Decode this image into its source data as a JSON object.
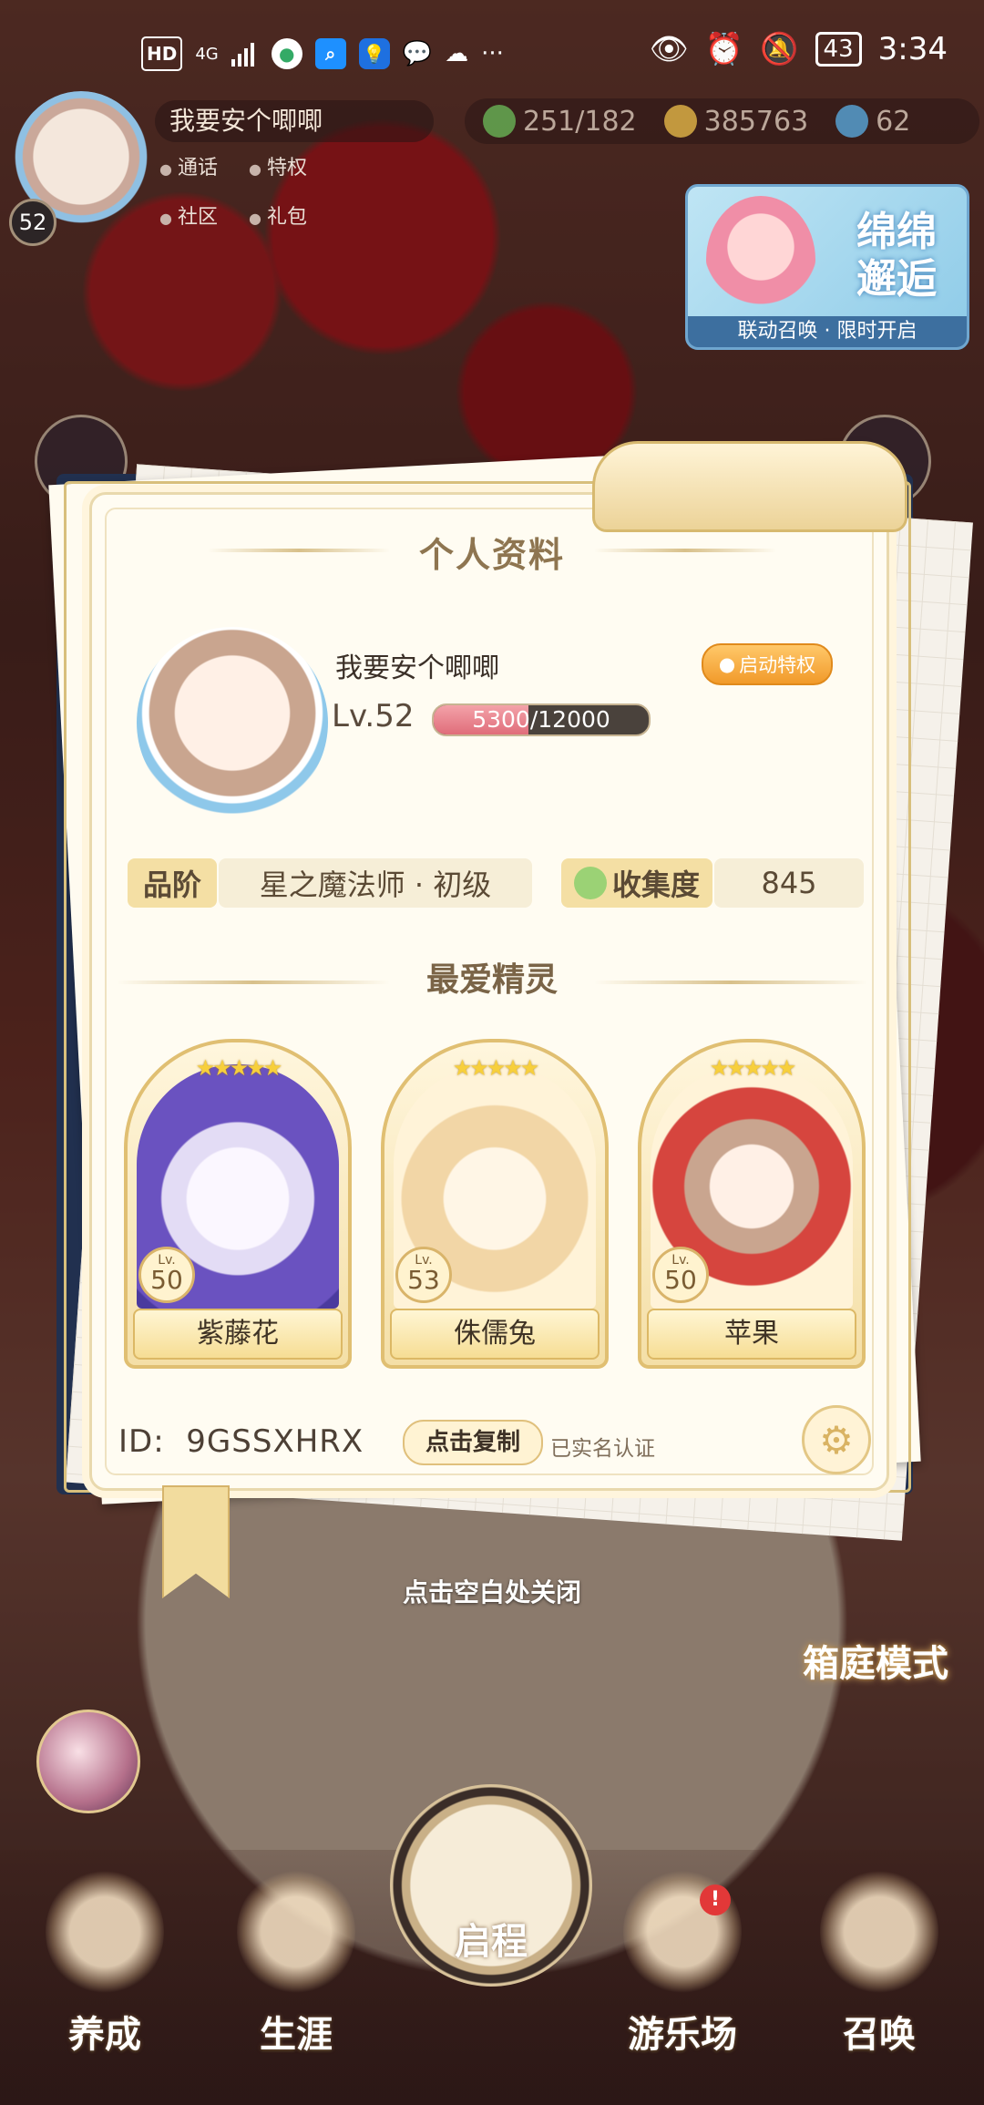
{
  "statusbar": {
    "network_hd": "HD",
    "network_type": "4G",
    "battery": "43",
    "time": "3:34",
    "more": "···"
  },
  "hud": {
    "level": "52",
    "player_name": "我要安个唧唧",
    "links": [
      "通话",
      "特权",
      "社区",
      "礼包"
    ],
    "currencies": [
      {
        "icon": "clover-icon",
        "value": "251/182",
        "color": "#6dbf5a"
      },
      {
        "icon": "coin-icon",
        "value": "385763",
        "color": "#f0c24b"
      },
      {
        "icon": "crystal-icon",
        "value": "62",
        "color": "#5ab0e8"
      }
    ]
  },
  "banner": {
    "title": "绵绵邂逅",
    "subtitle": "联动召唤 · 限时开启"
  },
  "profile": {
    "title": "个人资料",
    "name": "我要安个唧唧",
    "privilege_button": "启动特权",
    "level_label": "Lv.52",
    "xp_current": "5300",
    "xp_separator": "/12000",
    "xp_fraction": 0.4417,
    "rank_label": "品阶",
    "rank_value": "星之魔法师 · 初级",
    "collection_label": "收集度",
    "collection_value": "845",
    "favorites_title": "最爱精灵",
    "pets": [
      {
        "name": "紫藤花",
        "level": "50",
        "stars": "★★★★★",
        "color": "#7b6cc9"
      },
      {
        "name": "侏儒兔",
        "level": "53",
        "stars": "★★★★★",
        "color": "#f2d9a6"
      },
      {
        "name": "苹果",
        "level": "50",
        "stars": "★★★★★",
        "color": "#d6453e"
      }
    ],
    "level_prefix": "Lv.",
    "id_label": "ID:",
    "id_value": "9GSSXHRX",
    "copy_button": "点击复制",
    "verified": "已实名认证"
  },
  "close_hint": "点击空白处关闭",
  "garden_mode": "箱庭模式",
  "nav": {
    "items": [
      "养成",
      "生涯",
      "启程",
      "游乐场",
      "召唤"
    ],
    "badge": "!"
  }
}
